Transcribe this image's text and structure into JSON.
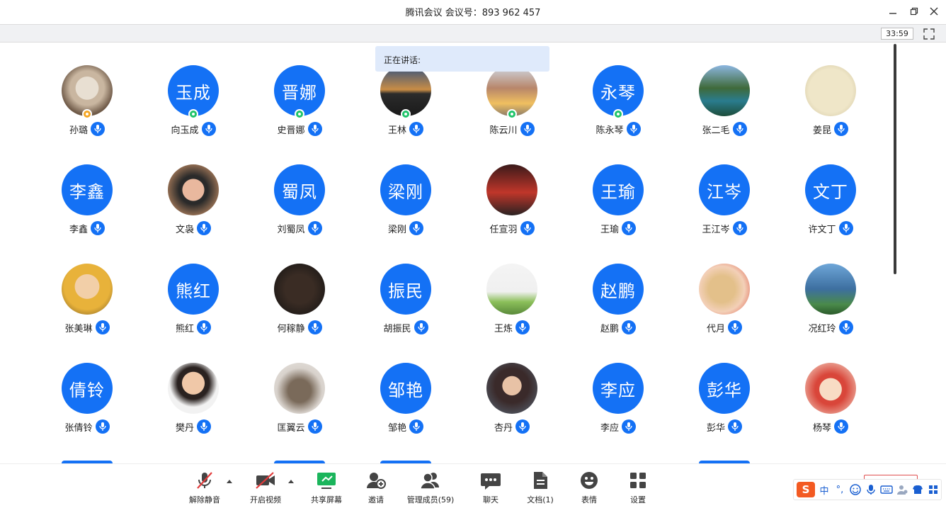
{
  "window": {
    "title": "腾讯会议 会议号：893 962 457",
    "timer": "33:59"
  },
  "speaking": {
    "label": "正在讲话:"
  },
  "colors": {
    "accent": "#1471f5",
    "host_badge": "#f5a623",
    "cohost_badge": "#1fc46a"
  },
  "participants": [
    {
      "name": "孙璐",
      "avatar_type": "photo",
      "avatar_desc": "plush-bunny-photo",
      "badge": "host"
    },
    {
      "name": "向玉成",
      "avatar_type": "text",
      "avatar_text": "玉成",
      "badge": "cohost"
    },
    {
      "name": "史晋娜",
      "avatar_type": "text",
      "avatar_text": "晋娜",
      "badge": "cohost"
    },
    {
      "name": "王林",
      "avatar_type": "photo",
      "avatar_desc": "sunset-bridge-photo",
      "badge": "cohost"
    },
    {
      "name": "陈云川",
      "avatar_type": "photo",
      "avatar_desc": "street-building-photo",
      "badge": "cohost"
    },
    {
      "name": "陈永琴",
      "avatar_type": "text",
      "avatar_text": "永琴",
      "badge": "cohost"
    },
    {
      "name": "张二毛",
      "avatar_type": "photo",
      "avatar_desc": "mountain-lake-photo",
      "badge": ""
    },
    {
      "name": "姜昆",
      "avatar_type": "photo",
      "avatar_desc": "calligraphy-photo",
      "badge": ""
    },
    {
      "name": "李鑫",
      "avatar_type": "text",
      "avatar_text": "李鑫",
      "badge": ""
    },
    {
      "name": "文袅",
      "avatar_type": "photo",
      "avatar_desc": "sunglasses-portrait-photo",
      "badge": ""
    },
    {
      "name": "刘蜀凤",
      "avatar_type": "text",
      "avatar_text": "蜀凤",
      "badge": ""
    },
    {
      "name": "梁刚",
      "avatar_type": "text",
      "avatar_text": "梁刚",
      "badge": ""
    },
    {
      "name": "任宣羽",
      "avatar_type": "photo",
      "avatar_desc": "red-sky-jet-photo",
      "badge": ""
    },
    {
      "name": "王瑜",
      "avatar_type": "text",
      "avatar_text": "王瑜",
      "badge": ""
    },
    {
      "name": "王江岑",
      "avatar_type": "text",
      "avatar_text": "江岑",
      "badge": ""
    },
    {
      "name": "许文丁",
      "avatar_type": "text",
      "avatar_text": "文丁",
      "badge": ""
    },
    {
      "name": "张美琳",
      "avatar_type": "photo",
      "avatar_desc": "baby-photo",
      "badge": ""
    },
    {
      "name": "熊红",
      "avatar_type": "text",
      "avatar_text": "熊红",
      "badge": ""
    },
    {
      "name": "何稼静",
      "avatar_type": "photo",
      "avatar_desc": "dark-logo-photo",
      "badge": ""
    },
    {
      "name": "胡振民",
      "avatar_type": "text",
      "avatar_text": "振民",
      "badge": ""
    },
    {
      "name": "王炼",
      "avatar_type": "photo",
      "avatar_desc": "basketball-hoop-photo",
      "badge": ""
    },
    {
      "name": "赵鹏",
      "avatar_type": "text",
      "avatar_text": "赵鹏",
      "badge": ""
    },
    {
      "name": "代月",
      "avatar_type": "photo",
      "avatar_desc": "dog-photo",
      "badge": ""
    },
    {
      "name": "况红玲",
      "avatar_type": "photo",
      "avatar_desc": "seaside-woman-photo",
      "badge": ""
    },
    {
      "name": "张倩铃",
      "avatar_type": "text",
      "avatar_text": "倩铃",
      "badge": ""
    },
    {
      "name": "樊丹",
      "avatar_type": "photo",
      "avatar_desc": "woman-portrait-photo",
      "badge": ""
    },
    {
      "name": "匡翼云",
      "avatar_type": "photo",
      "avatar_desc": "plush-toys-photo",
      "badge": ""
    },
    {
      "name": "邹艳",
      "avatar_type": "text",
      "avatar_text": "邹艳",
      "badge": ""
    },
    {
      "name": "杏丹",
      "avatar_type": "photo",
      "avatar_desc": "girl-portrait-photo",
      "badge": ""
    },
    {
      "name": "李应",
      "avatar_type": "text",
      "avatar_text": "李应",
      "badge": ""
    },
    {
      "name": "彭华",
      "avatar_type": "text",
      "avatar_text": "彭华",
      "badge": ""
    },
    {
      "name": "杨琴",
      "avatar_type": "photo",
      "avatar_desc": "cartoon-girl-photo",
      "badge": ""
    }
  ],
  "toolbar": {
    "unmute": "解除静音",
    "start_video": "开启视频",
    "share_screen": "共享屏幕",
    "invite": "邀请",
    "manage_members": "管理成员(59)",
    "chat": "聊天",
    "documents": "文档(1)",
    "reactions": "表情",
    "settings": "设置"
  },
  "ime": {
    "logo": "S",
    "lang": "中",
    "punct": "°,"
  }
}
